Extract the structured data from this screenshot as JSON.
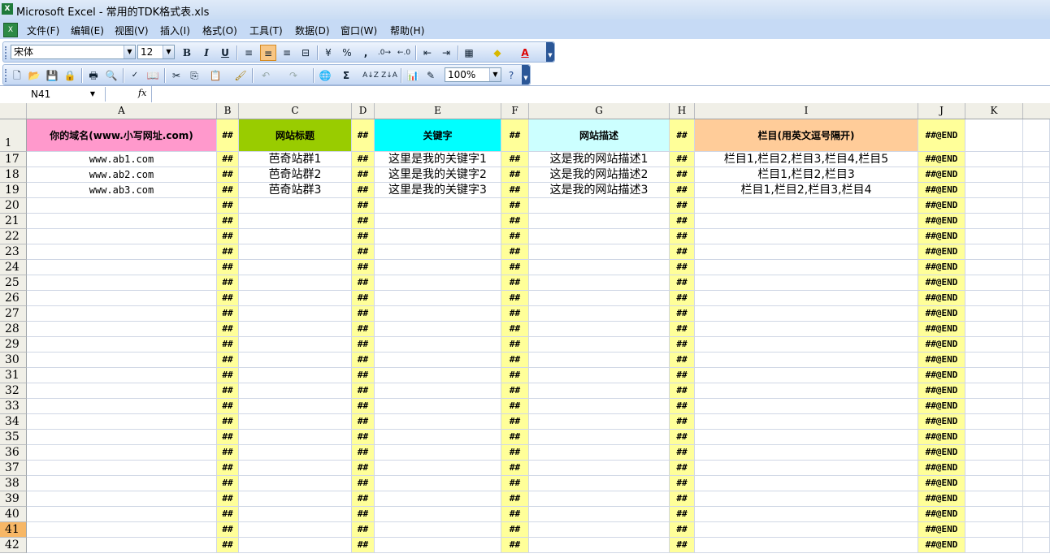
{
  "window": {
    "title": "Microsoft Excel - 常用的TDK格式表.xls",
    "app_icon": "excel-icon"
  },
  "menu": [
    "文件(F)",
    "编辑(E)",
    "视图(V)",
    "插入(I)",
    "格式(O)",
    "工具(T)",
    "数据(D)",
    "窗口(W)",
    "帮助(H)"
  ],
  "format_toolbar": {
    "font": "宋体",
    "size": "12"
  },
  "standard_toolbar": {
    "zoom": "100%"
  },
  "formula_bar": {
    "name_box": "N41",
    "fx": "fx",
    "content": ""
  },
  "columns": [
    "A",
    "B",
    "C",
    "D",
    "E",
    "F",
    "G",
    "H",
    "I",
    "J",
    "K"
  ],
  "header_row": {
    "row": "1",
    "a": "你的域名(www.小写网址.com)",
    "b": "##",
    "c": "网站标题",
    "d": "##",
    "e": "关键字",
    "f": "##",
    "g": "网站描述",
    "h": "##",
    "i": "栏目(用英文逗号隔开)",
    "j": "##@END"
  },
  "rows": [
    {
      "row": "17",
      "a": "www.ab1.com",
      "c": "芭奇站群1",
      "e": "这里是我的关键字1",
      "g": "这是我的网站描述1",
      "i": "栏目1,栏目2,栏目3,栏目4,栏目5"
    },
    {
      "row": "18",
      "a": "www.ab2.com",
      "c": "芭奇站群2",
      "e": "这里是我的关键字2",
      "g": "这是我的网站描述2",
      "i": "栏目1,栏目2,栏目3"
    },
    {
      "row": "19",
      "a": "www.ab3.com",
      "c": "芭奇站群3",
      "e": "这里是我的关键字3",
      "g": "这是我的网站描述3",
      "i": "栏目1,栏目2,栏目3,栏目4"
    },
    {
      "row": "20"
    },
    {
      "row": "21"
    },
    {
      "row": "22"
    },
    {
      "row": "23"
    },
    {
      "row": "24"
    },
    {
      "row": "25"
    },
    {
      "row": "26"
    },
    {
      "row": "27"
    },
    {
      "row": "28"
    },
    {
      "row": "29"
    },
    {
      "row": "30"
    },
    {
      "row": "31"
    },
    {
      "row": "32"
    },
    {
      "row": "33"
    },
    {
      "row": "34"
    },
    {
      "row": "35"
    },
    {
      "row": "36"
    },
    {
      "row": "37"
    },
    {
      "row": "38"
    },
    {
      "row": "39"
    },
    {
      "row": "40"
    },
    {
      "row": "41"
    },
    {
      "row": "42"
    }
  ],
  "filler": {
    "hash": "##",
    "end": "##@END"
  },
  "active_row": "41",
  "colors": {
    "a_header": "#ff99cc",
    "c_header": "#99cc00",
    "e_header": "#00ffff",
    "g_header": "#ccffff",
    "i_header": "#ffcc99",
    "separator_col": "#ffff99"
  }
}
